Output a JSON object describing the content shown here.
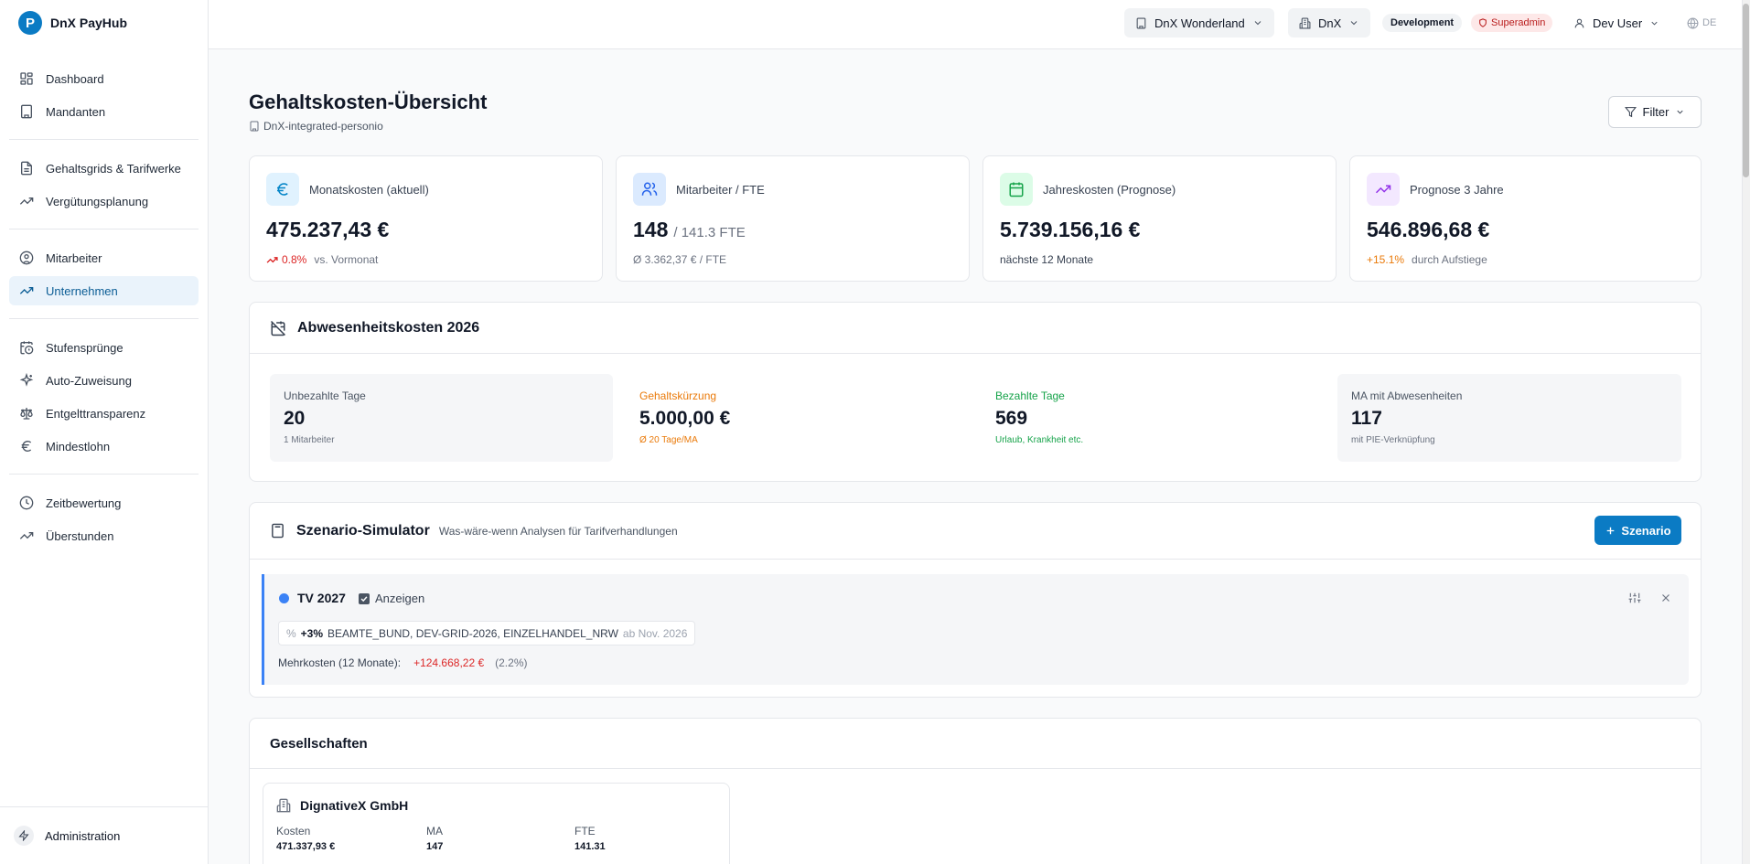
{
  "brand": {
    "name": "DnX PayHub"
  },
  "sidebar": {
    "groups": [
      [
        {
          "label": "Dashboard",
          "icon": "layout-grid-icon"
        },
        {
          "label": "Mandanten",
          "icon": "building-icon"
        }
      ],
      [
        {
          "label": "Gehaltsgrids & Tarifwerke",
          "icon": "document-icon"
        },
        {
          "label": "Vergütungsplanung",
          "icon": "trending-up-icon"
        }
      ],
      [
        {
          "label": "Mitarbeiter",
          "icon": "user-circle-icon"
        },
        {
          "label": "Unternehmen",
          "icon": "trending-up-icon",
          "active": true
        }
      ],
      [
        {
          "label": "Stufensprünge",
          "icon": "calendar-clock-icon"
        },
        {
          "label": "Auto-Zuweisung",
          "icon": "sparkles-icon"
        },
        {
          "label": "Entgelttransparenz",
          "icon": "scale-icon"
        },
        {
          "label": "Mindestlohn",
          "icon": "euro-icon"
        }
      ],
      [
        {
          "label": "Zeitbewertung",
          "icon": "clock-icon"
        },
        {
          "label": "Überstunden",
          "icon": "trending-up-icon"
        }
      ]
    ],
    "bottom_label": "Administration"
  },
  "topbar": {
    "tenant": "DnX Wonderland",
    "company": "DnX",
    "env_badge": "Development",
    "role_badge": "Superadmin",
    "user": "Dev User",
    "lang": "DE"
  },
  "page": {
    "title": "Gehaltskosten-Übersicht",
    "subtitle": "DnX-integrated-personio",
    "filter_label": "Filter"
  },
  "kpis": [
    {
      "label": "Monatskosten (aktuell)",
      "value": "475.237,43 €",
      "trend": "0.8%",
      "sub": "vs. Vormonat",
      "icon": "euro-icon",
      "bg": "#e0f2fe",
      "fg": "#0284c7"
    },
    {
      "label": "Mitarbeiter / FTE",
      "value": "148",
      "value_extra": "/ 141.3 FTE",
      "sub": "Ø 3.362,37 € / FTE",
      "icon": "users-icon",
      "bg": "#dbeafe",
      "fg": "#2563eb"
    },
    {
      "label": "Jahreskosten (Prognose)",
      "value": "5.739.156,16 €",
      "sub": "nächste 12 Monate",
      "icon": "calendar-icon",
      "bg": "#dcfce7",
      "fg": "#16a34a"
    },
    {
      "label": "Prognose 3 Jahre",
      "value": "546.896,68 €",
      "trend": "+15.1%",
      "sub": "durch Aufstiege",
      "icon": "trending-up-icon",
      "bg": "#f3e8ff",
      "fg": "#9333ea"
    }
  ],
  "absence": {
    "title": "Abwesenheitskosten 2026",
    "stats": [
      {
        "label": "Unbezahlte Tage",
        "value": "20",
        "note": "1 Mitarbeiter"
      },
      {
        "label": "Gehaltskürzung",
        "value": "5.000,00 €",
        "note": "Ø 20 Tage/MA"
      },
      {
        "label": "Bezahlte Tage",
        "value": "569",
        "note": "Urlaub, Krankheit etc."
      },
      {
        "label": "MA mit Abwesenheiten",
        "value": "117",
        "note": "mit PIE-Verknüpfung"
      }
    ]
  },
  "scenario": {
    "title": "Szenario-Simulator",
    "subtitle": "Was-wäre-wenn Analysen für Tarifverhandlungen",
    "add_button": "Szenario",
    "item": {
      "name": "TV 2027",
      "show_label": "Anzeigen",
      "pct_symbol": "%",
      "increase": "+3%",
      "grids": "BEAMTE_BUND, DEV-GRID-2026, EINZELHANDEL_NRW",
      "from": "ab Nov. 2026",
      "cost_label": "Mehrkosten (12 Monate):",
      "cost_value": "+124.668,22 €",
      "cost_pct": "(2.2%)"
    }
  },
  "companies": {
    "title": "Gesellschaften",
    "items": [
      {
        "name": "DignativeX GmbH",
        "cost_label": "Kosten",
        "cost": "471.337,93 €",
        "ma_label": "MA",
        "ma": "147",
        "fte_label": "FTE",
        "fte": "141.31"
      }
    ]
  },
  "colors": {
    "accent": "#0b7bc4",
    "trend_red": "#dc2626",
    "orange": "#ea7a0a",
    "green": "#16a34a",
    "scenario_blue": "#3b82f6"
  }
}
